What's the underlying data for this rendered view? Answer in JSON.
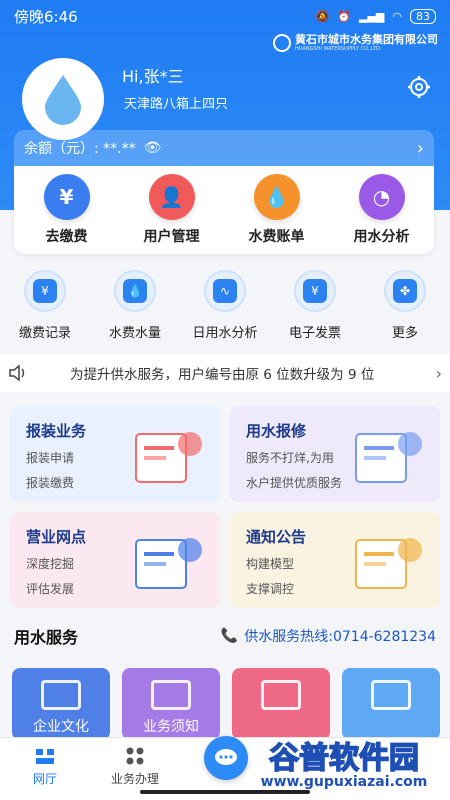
{
  "status": {
    "time": "傍晚6:46",
    "battery": "83"
  },
  "brand": {
    "name": "黄石市城市水务集团有限公司",
    "sub": "HUANGSHI WATERSUPPLY CO.,LTD."
  },
  "user": {
    "greeting": "Hi,张*三",
    "address": "天津路八箱上四只"
  },
  "balance": {
    "label": "余额（元）: **.**"
  },
  "quick": [
    {
      "label": "去缴费",
      "icon": "yuan-icon",
      "color": "#3a7df0",
      "glyph": "¥"
    },
    {
      "label": "用户管理",
      "icon": "user-icon",
      "color": "#f05a5a",
      "glyph": "👤"
    },
    {
      "label": "水费账单",
      "icon": "water-drop-icon",
      "color": "#f5922c",
      "glyph": "💧"
    },
    {
      "label": "用水分析",
      "icon": "pie-chart-icon",
      "color": "#9b59e8",
      "glyph": "◔"
    }
  ],
  "grid": [
    {
      "label": "缴费记录",
      "icon": "receipt-icon",
      "glyph": "¥"
    },
    {
      "label": "水费水量",
      "icon": "drop-icon",
      "glyph": "💧"
    },
    {
      "label": "日用水分析",
      "icon": "line-chart-icon",
      "glyph": "∿"
    },
    {
      "label": "电子发票",
      "icon": "invoice-icon",
      "glyph": "¥"
    },
    {
      "label": "更多",
      "icon": "more-icon",
      "glyph": "✤"
    }
  ],
  "notice": {
    "text": "为提升供水服务，用户编号由原 6 位数升级为 9 位"
  },
  "cards": [
    {
      "title": "报装业务",
      "line1": "报装申请",
      "line2": "报装缴费",
      "icon": "application-illustration"
    },
    {
      "title": "用水报修",
      "line1": "服务不打烊,为用",
      "line2": "水户提供优质服务",
      "icon": "repair-illustration"
    },
    {
      "title": "营业网点",
      "line1": "深度挖掘",
      "line2": "评估发展",
      "icon": "network-illustration"
    },
    {
      "title": "通知公告",
      "line1": "构建模型",
      "line2": "支撑调控",
      "icon": "announcement-illustration"
    }
  ],
  "service": {
    "title": "用水服务",
    "hotline": "供水服务热线:0714-6281234"
  },
  "tiles": [
    {
      "label": "企业文化"
    },
    {
      "label": "业务须知"
    },
    {
      "label": ""
    },
    {
      "label": ""
    }
  ],
  "tabs": [
    {
      "label": "网厅",
      "icon": "home-icon"
    },
    {
      "label": "业务办理",
      "icon": "grid-icon"
    }
  ],
  "watermark": {
    "text": "谷普软件园",
    "url": "www.gupuxiazai.com"
  }
}
